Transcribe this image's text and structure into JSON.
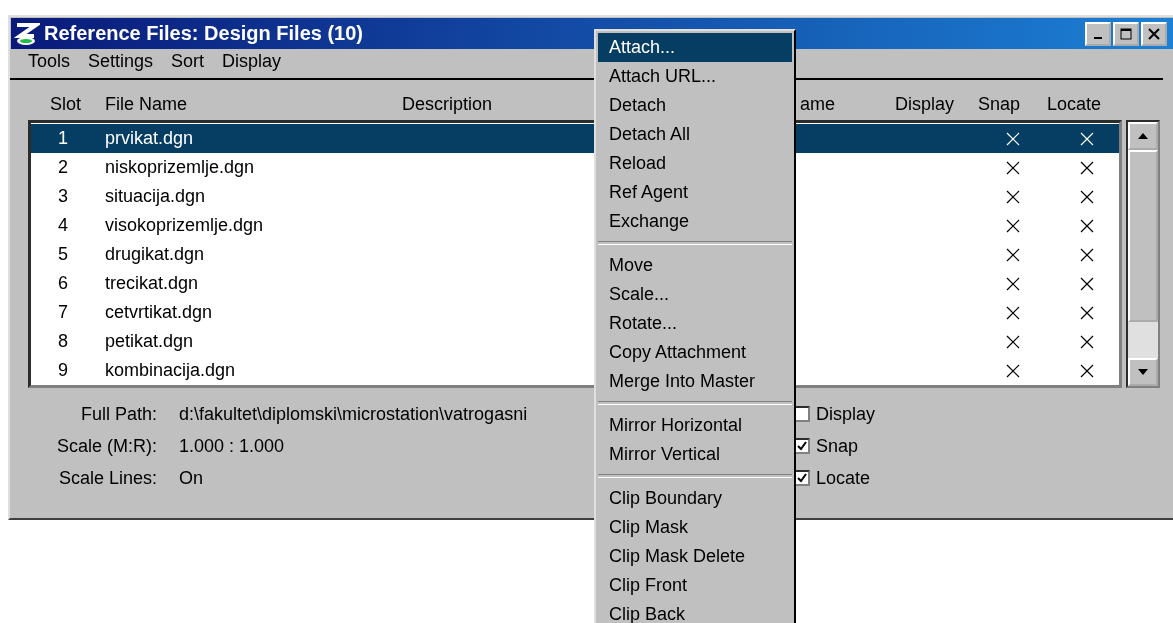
{
  "window": {
    "title": "Reference Files: Design Files (10)"
  },
  "menu_bar": [
    "Tools",
    "Settings",
    "Sort",
    "Display"
  ],
  "table": {
    "columns": [
      "Slot",
      "File Name",
      "Description",
      "ame",
      "Display",
      "Snap",
      "Locate"
    ],
    "rows": [
      {
        "slot": "1",
        "file_name": "prvikat.dgn",
        "snap": true,
        "locate": true,
        "selected": true
      },
      {
        "slot": "2",
        "file_name": "niskoprizemlje.dgn",
        "snap": true,
        "locate": true,
        "selected": false
      },
      {
        "slot": "3",
        "file_name": "situacija.dgn",
        "snap": true,
        "locate": true,
        "selected": false
      },
      {
        "slot": "4",
        "file_name": "visokoprizemlje.dgn",
        "snap": true,
        "locate": true,
        "selected": false
      },
      {
        "slot": "5",
        "file_name": "drugikat.dgn",
        "snap": true,
        "locate": true,
        "selected": false
      },
      {
        "slot": "6",
        "file_name": "trecikat.dgn",
        "snap": true,
        "locate": true,
        "selected": false
      },
      {
        "slot": "7",
        "file_name": "cetvrtikat.dgn",
        "snap": true,
        "locate": true,
        "selected": false
      },
      {
        "slot": "8",
        "file_name": "petikat.dgn",
        "snap": true,
        "locate": true,
        "selected": false
      },
      {
        "slot": "9",
        "file_name": "kombinacija.dgn",
        "snap": true,
        "locate": true,
        "selected": false
      }
    ]
  },
  "details": [
    {
      "label": "Full Path:",
      "value": "d:\\fakultet\\diplomski\\microstation\\vatrogasni"
    },
    {
      "label": "Scale (M:R):",
      "value": "1.000 : 1.000"
    },
    {
      "label": "Scale Lines:",
      "value": "On"
    }
  ],
  "options": [
    {
      "label": "Display",
      "checked": false
    },
    {
      "label": "Snap",
      "checked": true
    },
    {
      "label": "Locate",
      "checked": true
    }
  ],
  "context_menu": [
    {
      "kind": "item",
      "label": "Attach...",
      "selected": true
    },
    {
      "kind": "item",
      "label": "Attach URL...",
      "selected": false
    },
    {
      "kind": "item",
      "label": "Detach",
      "selected": false
    },
    {
      "kind": "item",
      "label": "Detach All",
      "selected": false
    },
    {
      "kind": "item",
      "label": "Reload",
      "selected": false
    },
    {
      "kind": "item",
      "label": "Ref Agent",
      "selected": false
    },
    {
      "kind": "item",
      "label": "Exchange",
      "selected": false
    },
    {
      "kind": "separator"
    },
    {
      "kind": "item",
      "label": "Move",
      "selected": false
    },
    {
      "kind": "item",
      "label": "Scale...",
      "selected": false
    },
    {
      "kind": "item",
      "label": "Rotate...",
      "selected": false
    },
    {
      "kind": "item",
      "label": "Copy Attachment",
      "selected": false
    },
    {
      "kind": "item",
      "label": "Merge Into Master",
      "selected": false
    },
    {
      "kind": "separator"
    },
    {
      "kind": "item",
      "label": "Mirror Horizontal",
      "selected": false
    },
    {
      "kind": "item",
      "label": "Mirror Vertical",
      "selected": false
    },
    {
      "kind": "separator"
    },
    {
      "kind": "item",
      "label": "Clip Boundary",
      "selected": false
    },
    {
      "kind": "item",
      "label": "Clip Mask",
      "selected": false
    },
    {
      "kind": "item",
      "label": "Clip Mask Delete",
      "selected": false
    },
    {
      "kind": "item",
      "label": "Clip Front",
      "selected": false
    },
    {
      "kind": "item",
      "label": "Clip Back",
      "selected": false
    }
  ]
}
